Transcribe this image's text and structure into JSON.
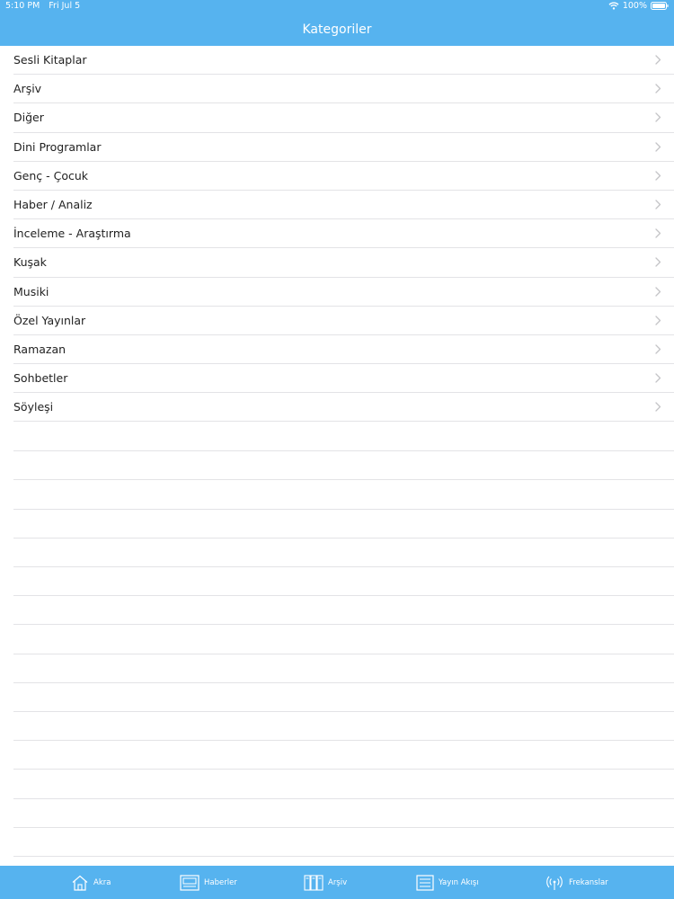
{
  "status_bar": {
    "time": "5:10 PM",
    "date": "Fri Jul 5",
    "battery": "100%"
  },
  "nav": {
    "title": "Kategoriler"
  },
  "categories": [
    {
      "label": "Sesli Kitaplar"
    },
    {
      "label": "Arşiv"
    },
    {
      "label": "Diğer"
    },
    {
      "label": "Dini Programlar"
    },
    {
      "label": "Genç - Çocuk"
    },
    {
      "label": "Haber / Analiz"
    },
    {
      "label": "İnceleme - Araştırma"
    },
    {
      "label": "Kuşak"
    },
    {
      "label": "Musiki"
    },
    {
      "label": "Özel Yayınlar"
    },
    {
      "label": "Ramazan"
    },
    {
      "label": "Sohbetler"
    },
    {
      "label": "Söyleşi"
    }
  ],
  "tabs": [
    {
      "label": "Akra",
      "icon": "home-icon"
    },
    {
      "label": "Haberler",
      "icon": "news-icon"
    },
    {
      "label": "Arşiv",
      "icon": "archive-icon"
    },
    {
      "label": "Yayın Akışı",
      "icon": "schedule-list-icon"
    },
    {
      "label": "Frekanslar",
      "icon": "antenna-icon"
    }
  ],
  "colors": {
    "bar": "#56b3ef",
    "separator": "#e3e3e6",
    "text": "#222222",
    "chevron": "#c4c4c7"
  }
}
